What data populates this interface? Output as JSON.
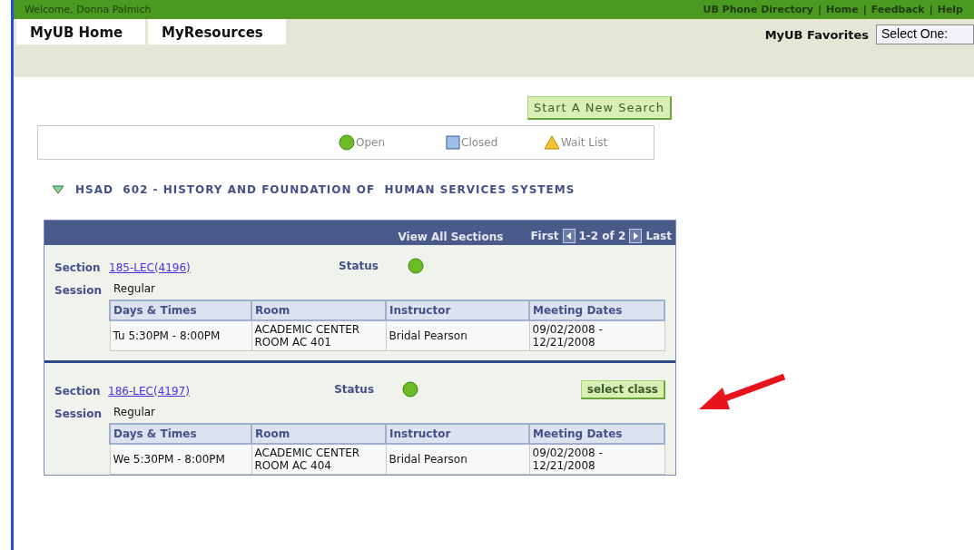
{
  "top_bar": {
    "welcome": "Welcome, Donna Palmich",
    "links": [
      "UB Phone Directory",
      "Home",
      "Feedback",
      "Help"
    ],
    "separator": "|"
  },
  "nav": {
    "tabs": [
      {
        "label": "MyUB Home"
      },
      {
        "label": "MyResources"
      }
    ],
    "favorites_label": "MyUB Favorites",
    "favorites_value": "Select One:"
  },
  "search_button": "Start A New Search",
  "legend": [
    {
      "kind": "open",
      "label": "Open"
    },
    {
      "kind": "closed",
      "label": "Closed"
    },
    {
      "kind": "waitlist",
      "label": "Wait List"
    }
  ],
  "course": {
    "title": "HSAD  602 - HISTORY AND FOUNDATION OF  HUMAN SERVICES SYSTEMS",
    "expanded": true
  },
  "grid": {
    "view_all": "View All Sections",
    "first": "First",
    "range": "1-2 of 2",
    "last": "Last",
    "sections": [
      {
        "section_label": "Section",
        "section": "185-LEC(4196)",
        "status_label": "Status",
        "kind": "open",
        "session_label": "Session",
        "session": "Regular",
        "columns": [
          "Days & Times",
          "Room",
          "Instructor",
          "Meeting Dates"
        ],
        "row": [
          "Tu 5:30PM - 8:00PM",
          "ACADEMIC CENTER ROOM AC 401",
          "Bridal Pearson",
          "09/02/2008 - 12/21/2008"
        ]
      },
      {
        "section_label": "Section",
        "section": "186-LEC(4197)",
        "status_label": "Status",
        "kind": "open",
        "button": "select class",
        "session_label": "Session",
        "session": "Regular",
        "columns": [
          "Days & Times",
          "Room",
          "Instructor",
          "Meeting Dates"
        ],
        "row": [
          "We 5:30PM - 8:00PM",
          "ACADEMIC CENTER ROOM AC 404",
          "Bridal Pearson",
          "09/02/2008 - 12/21/2008"
        ]
      }
    ]
  }
}
